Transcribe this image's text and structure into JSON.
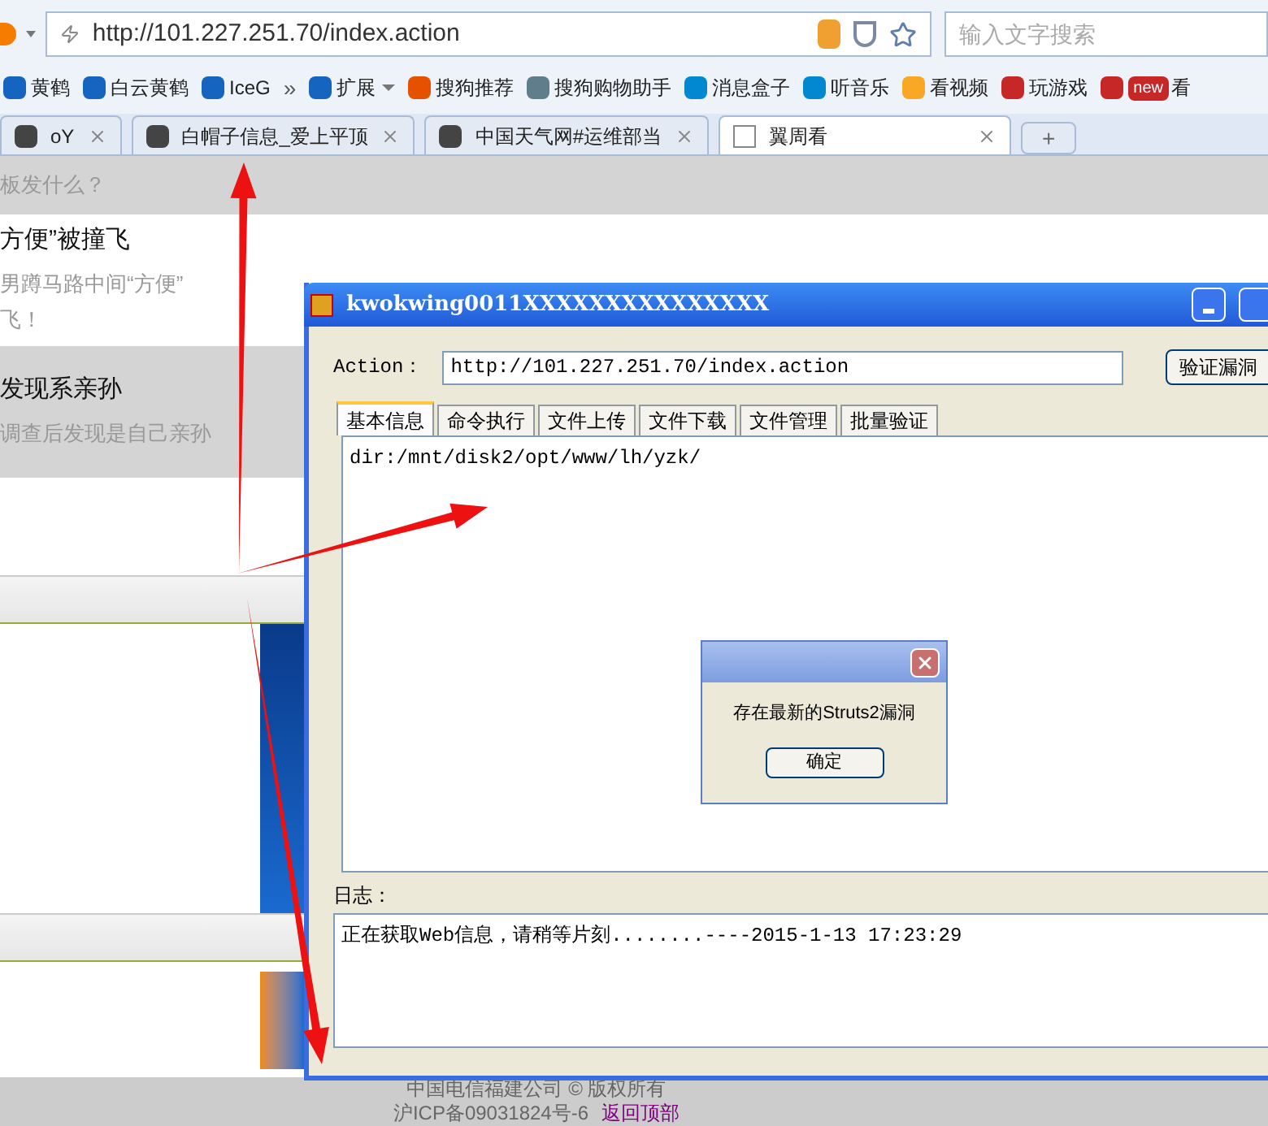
{
  "browser": {
    "url": "http://101.227.251.70/index.action",
    "search_placeholder": "输入文字搜索"
  },
  "bookmarks": [
    {
      "kind": "link",
      "label": "黄鹤"
    },
    {
      "kind": "link",
      "label": "白云黄鹤"
    },
    {
      "kind": "link",
      "label": "IceG"
    },
    {
      "kind": "more",
      "label": "»"
    },
    {
      "kind": "menu",
      "label": "扩展"
    },
    {
      "kind": "link",
      "label": "搜狗推荐"
    },
    {
      "kind": "link",
      "label": "搜狗购物助手"
    },
    {
      "kind": "link",
      "label": "消息盒子"
    },
    {
      "kind": "link",
      "label": "听音乐"
    },
    {
      "kind": "link",
      "label": "看视频"
    },
    {
      "kind": "link",
      "label": "玩游戏"
    },
    {
      "kind": "new",
      "label": "看",
      "badge": "new"
    }
  ],
  "tabs": [
    {
      "label": "oY",
      "selected": false
    },
    {
      "label": "白帽子信息_爱上平顶",
      "selected": false
    },
    {
      "label": "中国天气网#运维部当",
      "selected": false
    },
    {
      "label": "翼周看",
      "selected": true
    }
  ],
  "new_tab": "+",
  "news": [
    {
      "highlighted": true,
      "summary": [
        "板发什么？"
      ]
    },
    {
      "highlighted": false,
      "title": "方便”被撞飞",
      "summary": [
        "男蹲马路中间“方便”",
        "飞！"
      ]
    },
    {
      "highlighted": true,
      "title": "发现系亲孙",
      "summary": [
        "调查后发现是自己亲孙"
      ]
    }
  ],
  "app": {
    "title": "kwokwing0011XXXXXXXXXXXXXXX",
    "action_label": "Action：",
    "action_url": "http://101.227.251.70/index.action",
    "verify_button": "验证漏洞",
    "tabs": [
      {
        "label": "基本信息",
        "selected": true
      },
      {
        "label": "命令执行",
        "selected": false
      },
      {
        "label": "文件上传",
        "selected": false
      },
      {
        "label": "文件下载",
        "selected": false
      },
      {
        "label": "文件管理",
        "selected": false
      },
      {
        "label": "批量验证",
        "selected": false
      }
    ],
    "output": "dir:/mnt/disk2/opt/www/lh/yzk/",
    "log_label": "日志：",
    "log": "正在获取Web信息，请稍等片刻........----2015-1-13 17:23:29"
  },
  "dialog": {
    "message": "存在最新的Struts2漏洞",
    "ok_button": "确定"
  },
  "footer": {
    "copyright": "中国电信福建公司 © 版权所有",
    "icp": "沪ICP备09031824号-6",
    "back_to_top": "返回顶部"
  }
}
